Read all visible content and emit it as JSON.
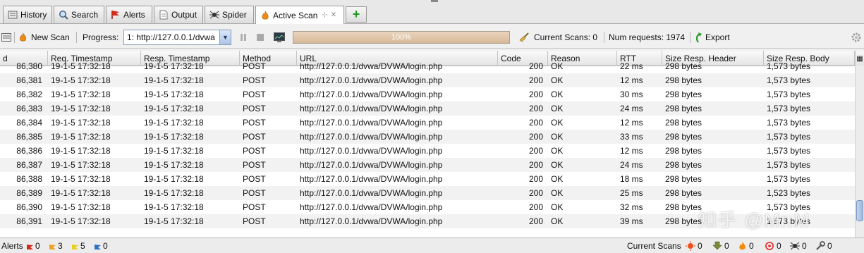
{
  "tabs": [
    {
      "label": "History",
      "icon": "history-icon"
    },
    {
      "label": "Search",
      "icon": "search-icon"
    },
    {
      "label": "Alerts",
      "icon": "flag-icon"
    },
    {
      "label": "Output",
      "icon": "document-icon"
    },
    {
      "label": "Spider",
      "icon": "spider-icon"
    },
    {
      "label": "Active Scan",
      "icon": "flame-icon"
    }
  ],
  "toolbar": {
    "new_scan_label": "New Scan",
    "progress_label": "Progress:",
    "progress_select_value": "1: http://127.0.0.1/dvwa",
    "progress_percent_text": "100%",
    "current_scans_label": "Current Scans: 0",
    "num_requests_label": "Num requests: 1974",
    "export_label": "Export"
  },
  "table": {
    "columns": [
      "d",
      "Req. Timestamp",
      "Resp. Timestamp",
      "Method",
      "URL",
      "Code",
      "Reason",
      "RTT",
      "Size Resp. Header",
      "Size Resp. Body"
    ],
    "rows": [
      [
        "86,380",
        "19-1-5 17:32:18",
        "19-1-5 17:32:18",
        "POST",
        "http://127.0.0.1/dvwa/DVWA/login.php",
        "200",
        "OK",
        "22 ms",
        "298 bytes",
        "1,573 bytes"
      ],
      [
        "86,381",
        "19-1-5 17:32:18",
        "19-1-5 17:32:18",
        "POST",
        "http://127.0.0.1/dvwa/DVWA/login.php",
        "200",
        "OK",
        "12 ms",
        "298 bytes",
        "1,573 bytes"
      ],
      [
        "86,382",
        "19-1-5 17:32:18",
        "19-1-5 17:32:18",
        "POST",
        "http://127.0.0.1/dvwa/DVWA/login.php",
        "200",
        "OK",
        "30 ms",
        "298 bytes",
        "1,573 bytes"
      ],
      [
        "86,383",
        "19-1-5 17:32:18",
        "19-1-5 17:32:18",
        "POST",
        "http://127.0.0.1/dvwa/DVWA/login.php",
        "200",
        "OK",
        "24 ms",
        "298 bytes",
        "1,573 bytes"
      ],
      [
        "86,384",
        "19-1-5 17:32:18",
        "19-1-5 17:32:18",
        "POST",
        "http://127.0.0.1/dvwa/DVWA/login.php",
        "200",
        "OK",
        "12 ms",
        "298 bytes",
        "1,573 bytes"
      ],
      [
        "86,385",
        "19-1-5 17:32:18",
        "19-1-5 17:32:18",
        "POST",
        "http://127.0.0.1/dvwa/DVWA/login.php",
        "200",
        "OK",
        "33 ms",
        "298 bytes",
        "1,573 bytes"
      ],
      [
        "86,386",
        "19-1-5 17:32:18",
        "19-1-5 17:32:18",
        "POST",
        "http://127.0.0.1/dvwa/DVWA/login.php",
        "200",
        "OK",
        "12 ms",
        "298 bytes",
        "1,573 bytes"
      ],
      [
        "86,387",
        "19-1-5 17:32:18",
        "19-1-5 17:32:18",
        "POST",
        "http://127.0.0.1/dvwa/DVWA/login.php",
        "200",
        "OK",
        "24 ms",
        "298 bytes",
        "1,573 bytes"
      ],
      [
        "86,388",
        "19-1-5 17:32:18",
        "19-1-5 17:32:18",
        "POST",
        "http://127.0.0.1/dvwa/DVWA/login.php",
        "200",
        "OK",
        "18 ms",
        "298 bytes",
        "1,573 bytes"
      ],
      [
        "86,389",
        "19-1-5 17:32:18",
        "19-1-5 17:32:18",
        "POST",
        "http://127.0.0.1/dvwa/DVWA/login.php",
        "200",
        "OK",
        "25 ms",
        "298 bytes",
        "1,523 bytes"
      ],
      [
        "86,390",
        "19-1-5 17:32:18",
        "19-1-5 17:32:18",
        "POST",
        "http://127.0.0.1/dvwa/DVWA/login.php",
        "200",
        "OK",
        "32 ms",
        "298 bytes",
        "1,573 bytes"
      ],
      [
        "86,391",
        "19-1-5 17:32:18",
        "19-1-5 17:32:18",
        "POST",
        "http://127.0.0.1/dvwa/DVWA/login.php",
        "200",
        "OK",
        "39 ms",
        "298 bytes",
        "1,573 bytes"
      ]
    ]
  },
  "statusbar": {
    "alerts_label": "Alerts",
    "alert_counts": [
      {
        "count": "0",
        "color": "#d42a1a"
      },
      {
        "count": "3",
        "color": "#f0a020"
      },
      {
        "count": "5",
        "color": "#e6d020"
      },
      {
        "count": "0",
        "color": "#3070c0"
      }
    ],
    "current_scans_label": "Current Scans",
    "scan_counts": [
      {
        "icon": "sun-icon",
        "count": "0"
      },
      {
        "icon": "download-icon",
        "count": "0"
      },
      {
        "icon": "flame-icon",
        "count": "0"
      },
      {
        "icon": "target-icon",
        "count": "0"
      },
      {
        "icon": "spider-icon",
        "count": "0"
      },
      {
        "icon": "wrench-icon",
        "count": "0"
      }
    ]
  },
  "watermark": "知乎 @Mr.M",
  "colors": {
    "progress_fill": "#d8b898",
    "selected_tab": "#ffffff",
    "alt_row": "#f2f2f2",
    "export_icon": "#2c9a2c",
    "flame": "#f08a10"
  }
}
